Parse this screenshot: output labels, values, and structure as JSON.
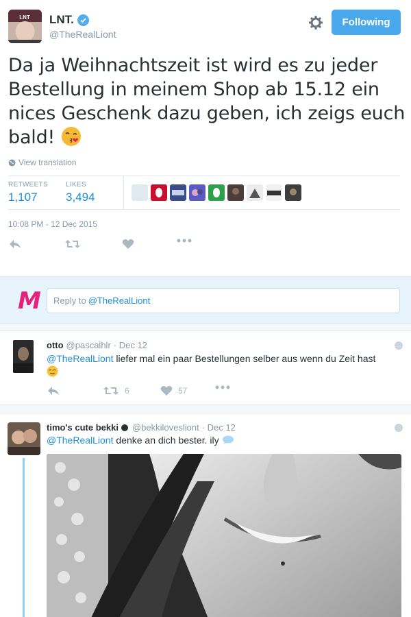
{
  "tweet": {
    "display_name": "LNT.",
    "handle": "@TheRealLiont",
    "follow_label": "Following",
    "text": "Da ja Weihnachtszeit ist wird es zu jeder Bestellung in meinem Shop ab 15.12 ein nices Geschenk dazu geben, ich zeigs euch bald!",
    "translate_label": "View translation",
    "stats": {
      "retweets_label": "RETWEETS",
      "retweets_value": "1,107",
      "likes_label": "LIKES",
      "likes_value": "3,494"
    },
    "timestamp": "10:08 PM - 12 Dec 2015",
    "icons": [
      "reply-icon",
      "retweet-icon",
      "like-icon",
      "more-icon",
      "gear-icon",
      "verified-icon",
      "globe-icon"
    ]
  },
  "reply_box": {
    "prefix": "Reply to",
    "mention": "@TheRealLiont"
  },
  "replies": [
    {
      "name": "otto",
      "handle": "@pascalhlr",
      "date": "· Dec 12",
      "mention": "@TheRealLiont",
      "text": "liefer mal ein paar Bestellungen selber aus wenn du Zeit hast",
      "retweets": "6",
      "likes": "57"
    },
    {
      "name": "timo's cute bekki",
      "handle": "@bekkiloveslio nt",
      "handle_display": "@bekkiloveslio nt",
      "handle_text": "@bekkilovesliont",
      "date": "· Dec 12",
      "mention": "@TheRealLiont",
      "text": "denke an dich bester. ily"
    }
  ],
  "colors": {
    "accent": "#1d8fd8",
    "follow_button": "#4aa8ec",
    "reply_bg": "#e8f4fb",
    "thread_line": "#8ed0f9",
    "logo_pink": "#e8207b"
  }
}
